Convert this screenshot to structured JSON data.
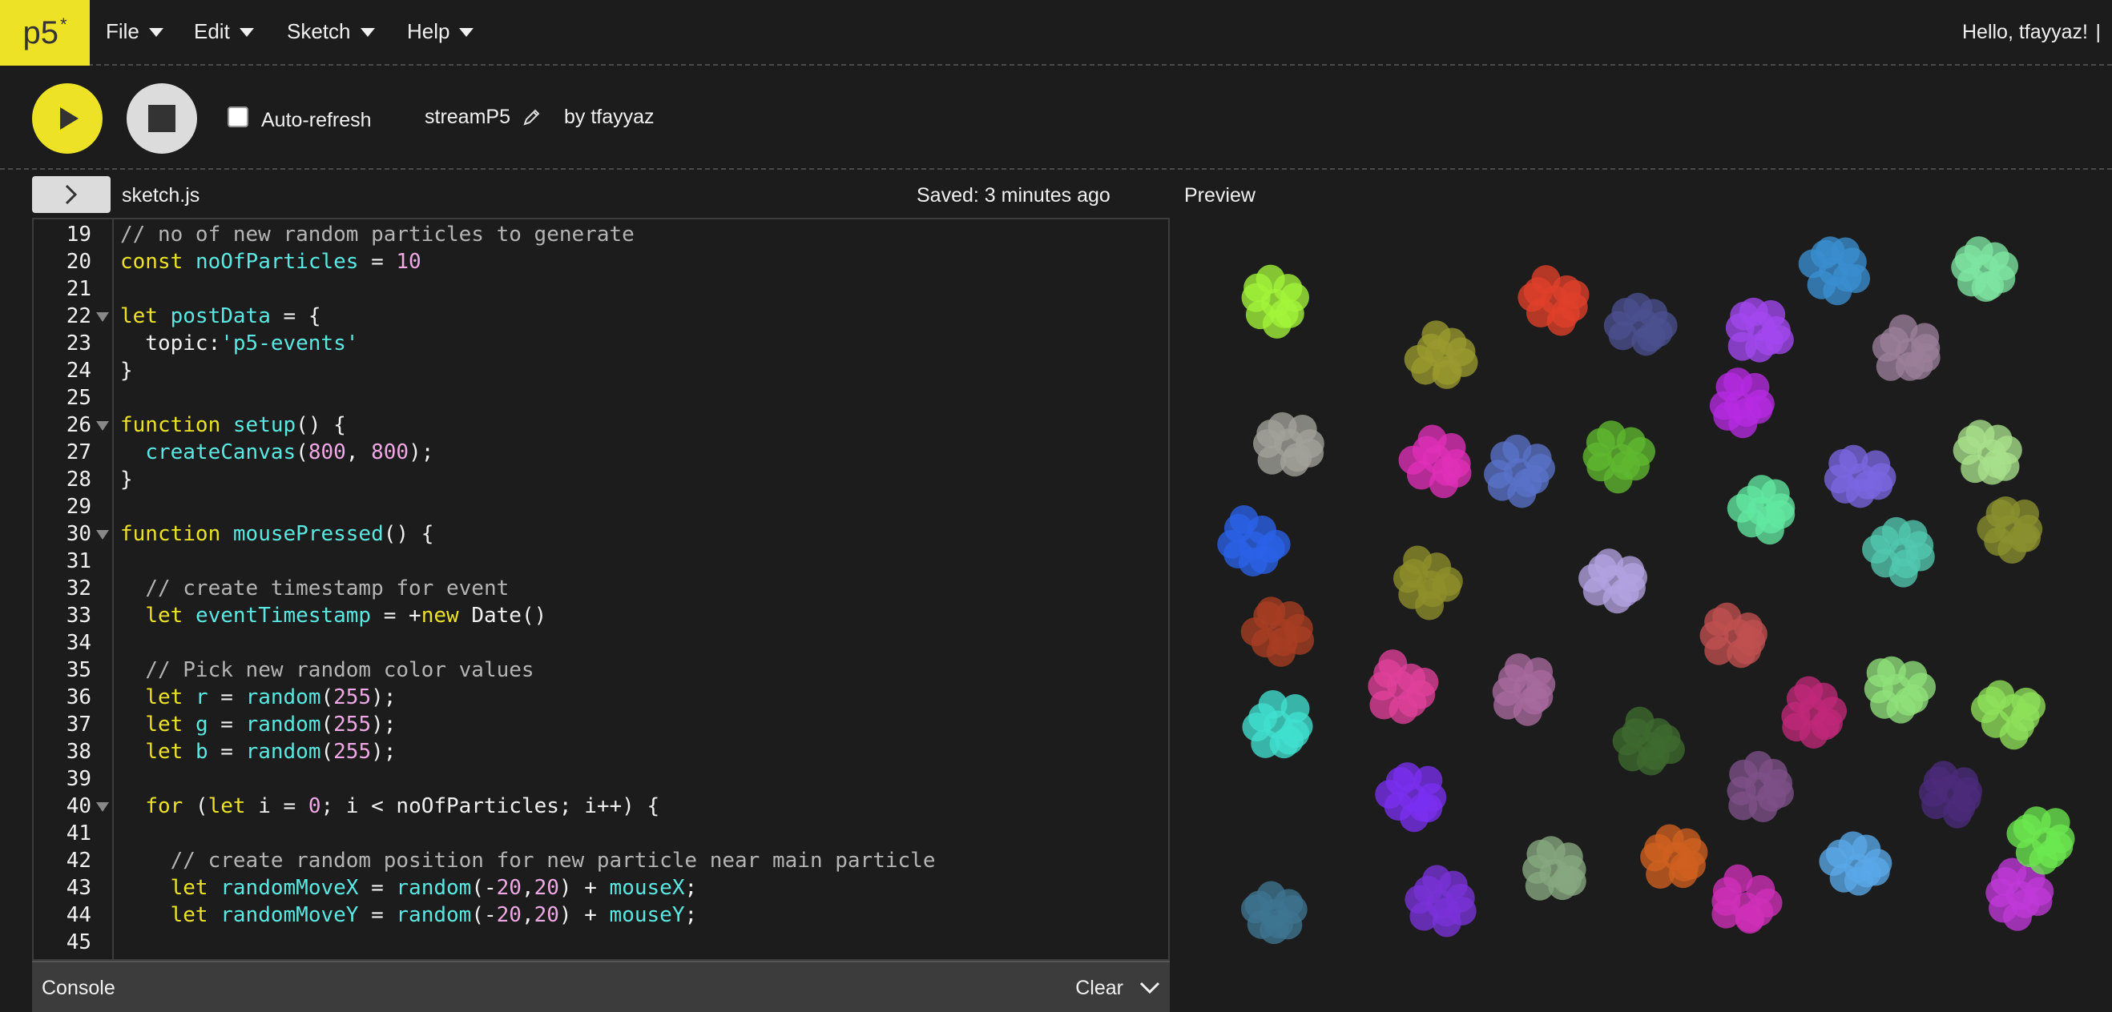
{
  "nav": {
    "logo": "p5",
    "logo_star": "*",
    "menus": [
      "File",
      "Edit",
      "Sketch",
      "Help"
    ],
    "greeting": "Hello, tfayyaz!",
    "greeting_separator": "|"
  },
  "toolbar": {
    "play_icon": "play-icon",
    "stop_icon": "stop-icon",
    "autorefresh_label": "Auto-refresh",
    "autorefresh_checked": false,
    "sketch_name": "streamP5",
    "by_owner": "by tfayyaz"
  },
  "editor": {
    "file_name": "sketch.js",
    "saved_status": "Saved: 3 minutes ago",
    "preview_label": "Preview",
    "lines": [
      {
        "n": "19",
        "fold": false,
        "html": "<span class='cm'>// no of new random particles to generate</span>"
      },
      {
        "n": "20",
        "fold": false,
        "html": "<span class='kw'>const</span> <span class='id'>noOfParticles</span> = <span class='nm'>10</span>"
      },
      {
        "n": "21",
        "fold": false,
        "html": ""
      },
      {
        "n": "22",
        "fold": true,
        "html": "<span class='kw'>let</span> <span class='id'>postData</span> = {"
      },
      {
        "n": "23",
        "fold": false,
        "html": "  topic:<span class='st'>'p5-events'</span>"
      },
      {
        "n": "24",
        "fold": false,
        "html": "}"
      },
      {
        "n": "25",
        "fold": false,
        "html": ""
      },
      {
        "n": "26",
        "fold": true,
        "html": "<span class='kw'>function</span> <span class='id'>setup</span>() {"
      },
      {
        "n": "27",
        "fold": false,
        "html": "  <span class='id'>createCanvas</span>(<span class='nm'>800</span>, <span class='nm'>800</span>);"
      },
      {
        "n": "28",
        "fold": false,
        "html": "}"
      },
      {
        "n": "29",
        "fold": false,
        "html": ""
      },
      {
        "n": "30",
        "fold": true,
        "html": "<span class='kw'>function</span> <span class='id'>mousePressed</span>() {"
      },
      {
        "n": "31",
        "fold": false,
        "html": ""
      },
      {
        "n": "32",
        "fold": false,
        "html": "  <span class='cm'>// create timestamp for event</span>"
      },
      {
        "n": "33",
        "fold": false,
        "html": "  <span class='kw'>let</span> <span class='id'>eventTimestamp</span> = +<span class='kw'>new</span> Date()"
      },
      {
        "n": "34",
        "fold": false,
        "html": ""
      },
      {
        "n": "35",
        "fold": false,
        "html": "  <span class='cm'>// Pick new random color values</span>"
      },
      {
        "n": "36",
        "fold": false,
        "html": "  <span class='kw'>let</span> <span class='id'>r</span> = <span class='id'>random</span>(<span class='nm'>255</span>);"
      },
      {
        "n": "37",
        "fold": false,
        "html": "  <span class='kw'>let</span> <span class='id'>g</span> = <span class='id'>random</span>(<span class='nm'>255</span>);"
      },
      {
        "n": "38",
        "fold": false,
        "html": "  <span class='kw'>let</span> <span class='id'>b</span> = <span class='id'>random</span>(<span class='nm'>255</span>);"
      },
      {
        "n": "39",
        "fold": false,
        "html": ""
      },
      {
        "n": "40",
        "fold": true,
        "html": "  <span class='kw'>for</span> (<span class='kw'>let</span> i = <span class='nm'>0</span>; i &lt; noOfParticles; i++) {"
      },
      {
        "n": "41",
        "fold": false,
        "html": ""
      },
      {
        "n": "42",
        "fold": false,
        "html": "    <span class='cm'>// create random position for new particle near main particle</span>"
      },
      {
        "n": "43",
        "fold": false,
        "html": "    <span class='kw'>let</span> <span class='id'>randomMoveX</span> = <span class='id'>random</span>(-<span class='nm'>20</span>,<span class='nm'>20</span>) + <span class='id'>mouseX</span>;"
      },
      {
        "n": "44",
        "fold": false,
        "html": "    <span class='kw'>let</span> <span class='id'>randomMoveY</span> = <span class='id'>random</span>(-<span class='nm'>20</span>,<span class='nm'>20</span>) + <span class='id'>mouseY</span>;"
      },
      {
        "n": "45",
        "fold": false,
        "html": ""
      }
    ]
  },
  "console": {
    "title": "Console",
    "clear_label": "Clear"
  },
  "preview": {
    "particle_clusters": [
      {
        "color": "#a3f53a"
      },
      {
        "color": "#9a9a2e"
      },
      {
        "color": "#e0402a"
      },
      {
        "color": "#4a4f8e"
      },
      {
        "color": "#a348f0"
      },
      {
        "color": "#3a8ed0"
      },
      {
        "color": "#7ee6a2"
      },
      {
        "color": "#9b7f9a"
      },
      {
        "color": "#a2a29a"
      },
      {
        "color": "#e02fb8"
      },
      {
        "color": "#5a72c8"
      },
      {
        "color": "#5fb82f"
      },
      {
        "color": "#b62ae2"
      },
      {
        "color": "#62e8a0"
      },
      {
        "color": "#7a66e0"
      },
      {
        "color": "#a8e08a"
      },
      {
        "color": "#2a62e8"
      },
      {
        "color": "#8e8e2a"
      },
      {
        "color": "#b2a2e0"
      },
      {
        "color": "#52c8b0"
      },
      {
        "color": "#8a8f2e"
      },
      {
        "color": "#a83e22"
      },
      {
        "color": "#e0409a"
      },
      {
        "color": "#c05050"
      },
      {
        "color": "#a86a9e"
      },
      {
        "color": "#40e0d0"
      },
      {
        "color": "#3e6a2e"
      },
      {
        "color": "#c02878"
      },
      {
        "color": "#90e07a"
      },
      {
        "color": "#8ee05a"
      },
      {
        "color": "#7a30f0"
      },
      {
        "color": "#7e4f88"
      },
      {
        "color": "#4a2a7a"
      },
      {
        "color": "#5aa8e8"
      },
      {
        "color": "#c038d8"
      },
      {
        "color": "#3e7490"
      },
      {
        "color": "#7a32d8"
      },
      {
        "color": "#86a880"
      },
      {
        "color": "#d06020"
      },
      {
        "color": "#d030b8"
      },
      {
        "color": "#6ce850"
      }
    ]
  }
}
